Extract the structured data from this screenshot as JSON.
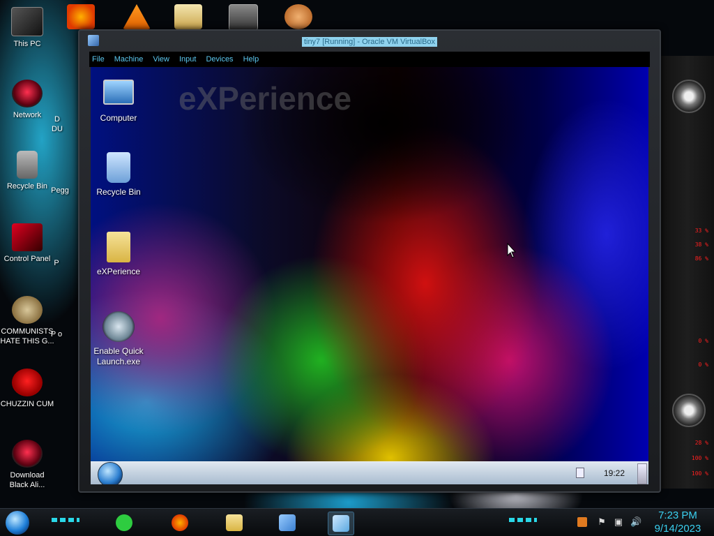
{
  "host_desktop": {
    "icons": [
      {
        "label": "This PC",
        "icon": "computer-icon"
      },
      {
        "label": "Network",
        "icon": "alien-network-icon"
      },
      {
        "label": "Recycle Bin",
        "icon": "recycle-bin-icon"
      },
      {
        "label": "Control Panel",
        "icon": "control-panel-icon"
      },
      {
        "label": "COMMUNISTS HATE THIS G...",
        "icon": "money-bag-icon"
      },
      {
        "label": "CHUZZIN CUM",
        "icon": "chuzzle-icon"
      },
      {
        "label": "Download Black Ali...",
        "icon": "alien-download-icon"
      }
    ],
    "partial_labels": [
      "D",
      "DU",
      "Pegg",
      "P",
      "P o"
    ]
  },
  "vbox_window": {
    "title": "tiny7 [Running] - Oracle VM VirtualBox",
    "menu": [
      "File",
      "Machine",
      "View",
      "Input",
      "Devices",
      "Help"
    ]
  },
  "guest": {
    "wordmark": "eXPerience",
    "icons": [
      {
        "label": "Computer",
        "icon": "computer-icon"
      },
      {
        "label": "Recycle Bin",
        "icon": "recycle-bin-icon"
      },
      {
        "label": "eXPerience",
        "icon": "folder-icon"
      },
      {
        "label": "Enable Quick Launch.exe",
        "icon": "quick-launch-icon"
      }
    ],
    "taskbar": {
      "clock": "19:22"
    }
  },
  "host_taskbar": {
    "pinned": [
      {
        "name": "notes-app-icon",
        "color": "#2ecc40"
      },
      {
        "name": "firefox-icon",
        "color": "#ff6a00"
      },
      {
        "name": "file-explorer-icon",
        "color": "#f0c040"
      },
      {
        "name": "virtualbox-icon",
        "color": "#3a7fd0"
      },
      {
        "name": "tiny7-vm-icon",
        "color": "#5aa8e0"
      }
    ],
    "clock_time": "7:23 PM",
    "clock_date": "9/14/2023"
  },
  "colors": {
    "accent_cyan": "#2ad8e8",
    "title_highlight": "#8fd2ee",
    "menu_text": "#5cc8f0"
  }
}
